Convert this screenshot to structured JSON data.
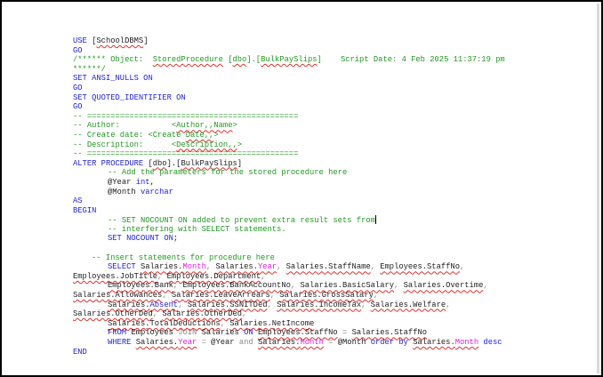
{
  "editor": {
    "lines": [
      {
        "ind": 0,
        "t": [
          [
            "k",
            "USE "
          ],
          [
            "t",
            "["
          ],
          [
            "t",
            "SchoolDBMS",
            1
          ],
          [
            "t",
            "]"
          ]
        ]
      },
      {
        "ind": 0,
        "t": [
          [
            "k",
            "GO"
          ]
        ]
      },
      {
        "ind": 0,
        "t": [
          [
            "c",
            "/****** Object:  "
          ],
          [
            "c",
            "StoredProcedure",
            1
          ],
          [
            "c",
            " ["
          ],
          [
            "c",
            "dbo",
            1
          ],
          [
            "c",
            "].["
          ],
          [
            "c",
            "BulkPaySlips",
            1
          ],
          [
            "c",
            "]    Script Date: 4 Feb 2025 11:37:19 pm"
          ]
        ]
      },
      {
        "ind": 0,
        "t": [
          [
            "c",
            "******/"
          ]
        ]
      },
      {
        "ind": 0,
        "t": [
          [
            "k",
            "SET ANSI_NULLS ON"
          ]
        ]
      },
      {
        "ind": 0,
        "t": [
          [
            "k",
            "GO"
          ]
        ]
      },
      {
        "ind": 0,
        "t": [
          [
            "k",
            "SET QUOTED_IDENTIFIER ON"
          ]
        ]
      },
      {
        "ind": 0,
        "t": [
          [
            "k",
            "GO"
          ]
        ]
      },
      {
        "ind": 0,
        "t": [
          [
            "c",
            "-- ============================================="
          ]
        ]
      },
      {
        "ind": 0,
        "t": [
          [
            "c",
            "-- Author:           <"
          ],
          [
            "c",
            "Author,,Name",
            1
          ],
          [
            "c",
            ">"
          ]
        ]
      },
      {
        "ind": 0,
        "t": [
          [
            "c",
            "-- Create date: <Create "
          ],
          [
            "c",
            "Date,,",
            1
          ],
          [
            "c",
            ">"
          ]
        ]
      },
      {
        "ind": 0,
        "t": [
          [
            "c",
            "-- Description:      <"
          ],
          [
            "c",
            "Description,,",
            1
          ],
          [
            "c",
            ">"
          ]
        ]
      },
      {
        "ind": 0,
        "t": [
          [
            "c",
            "-- ============================================="
          ]
        ]
      },
      {
        "ind": 0,
        "t": [
          [
            "k",
            "ALTER PROCEDURE "
          ],
          [
            "t",
            "["
          ],
          [
            "t",
            "dbo",
            1
          ],
          [
            "t",
            "].["
          ],
          [
            "t",
            "BulkPaySlips",
            1
          ],
          [
            "t",
            "]"
          ]
        ]
      },
      {
        "ind": 2,
        "t": [
          [
            "c",
            "-- Add the parameters for the stored procedure here"
          ]
        ]
      },
      {
        "ind": 2,
        "t": [
          [
            "t",
            "@Year "
          ],
          [
            "k",
            "int"
          ],
          [
            "t",
            ","
          ]
        ]
      },
      {
        "ind": 2,
        "t": [
          [
            "t",
            "@Month "
          ],
          [
            "k",
            "varchar"
          ]
        ]
      },
      {
        "ind": 0,
        "t": [
          [
            "k",
            "AS"
          ]
        ]
      },
      {
        "ind": 0,
        "t": [
          [
            "k",
            "BEGIN"
          ]
        ]
      },
      {
        "ind": 2,
        "t": [
          [
            "c",
            "-- SET NOCOUNT ON added to prevent extra result sets from"
          ]
        ],
        "caret": true
      },
      {
        "ind": 2,
        "t": [
          [
            "c",
            "-- interfering with SELECT statements."
          ]
        ]
      },
      {
        "ind": 2,
        "t": [
          [
            "k",
            "SET NOCOUNT ON"
          ],
          [
            "t",
            ";"
          ]
        ]
      },
      {
        "ind": 0,
        "t": []
      },
      {
        "ind": 1,
        "t": [
          [
            "c",
            "-- Insert statements for procedure here"
          ]
        ]
      },
      {
        "ind": 2,
        "t": [
          [
            "k",
            "SELECT "
          ],
          [
            "t",
            "Salaries.",
            1
          ],
          [
            "m",
            "Month",
            1
          ],
          [
            "g",
            ", "
          ],
          [
            "t",
            "Salaries.",
            1
          ],
          [
            "m",
            "Year",
            1
          ],
          [
            "g",
            ", "
          ],
          [
            "t",
            "Salaries.StaffName",
            1
          ],
          [
            "g",
            ", "
          ],
          [
            "t",
            "Employees.StaffNo",
            1
          ],
          [
            "g",
            ","
          ]
        ]
      },
      {
        "ind": 0,
        "t": [
          [
            "t",
            "Employees.JobTitle",
            1
          ],
          [
            "g",
            ", "
          ],
          [
            "t",
            "Employees.Department",
            1
          ],
          [
            "g",
            ","
          ]
        ]
      },
      {
        "ind": 2,
        "t": [
          [
            "t",
            "Employees.Bank",
            1
          ],
          [
            "g",
            ", "
          ],
          [
            "t",
            "Employees.BankAccountNo",
            1
          ],
          [
            "g",
            ", "
          ],
          [
            "t",
            "Salaries.BasicSalary",
            1
          ],
          [
            "g",
            ", "
          ],
          [
            "t",
            "Salaries.Overtime",
            1
          ],
          [
            "g",
            ","
          ]
        ]
      },
      {
        "ind": 0,
        "t": [
          [
            "t",
            "Salaries.Allowances",
            1
          ],
          [
            "g",
            ", "
          ],
          [
            "t",
            "Salaries.LeaveArrears",
            1
          ],
          [
            "g",
            ", "
          ],
          [
            "t",
            "Salaries.GrossSalary",
            1
          ],
          [
            "g",
            ","
          ]
        ]
      },
      {
        "ind": 2,
        "t": [
          [
            "t",
            "Salaries.",
            1
          ],
          [
            "k",
            "Absent",
            1
          ],
          [
            "g",
            ", "
          ],
          [
            "t",
            "Salaries.SSNITDed",
            1
          ],
          [
            "g",
            ", "
          ],
          [
            "t",
            "Salaries.IncomeTax",
            1
          ],
          [
            "g",
            ", "
          ],
          [
            "t",
            "Salaries.Welfare",
            1
          ],
          [
            "g",
            ","
          ]
        ]
      },
      {
        "ind": 0,
        "t": [
          [
            "t",
            "Salaries.OtherDed",
            1
          ],
          [
            "g",
            ", "
          ],
          [
            "t",
            "Salaries.OtherDed",
            1
          ],
          [
            "g",
            ","
          ]
        ]
      },
      {
        "ind": 2,
        "t": [
          [
            "t",
            "Salaries.TotalDeductions",
            1
          ],
          [
            "g",
            ", "
          ],
          [
            "t",
            "Salaries.NetIncome",
            1
          ]
        ]
      },
      {
        "ind": 2,
        "t": [
          [
            "k",
            "FROM "
          ],
          [
            "t",
            "Employees "
          ],
          [
            "g",
            "JOIN "
          ],
          [
            "t",
            "Salaries "
          ],
          [
            "k",
            "ON "
          ],
          [
            "t",
            "Employees.StaffNo",
            1
          ],
          [
            "g",
            " = "
          ],
          [
            "t",
            "Salaries.StaffNo",
            1
          ]
        ]
      },
      {
        "ind": 2,
        "t": [
          [
            "k",
            "WHERE "
          ],
          [
            "t",
            "Salaries.",
            1
          ],
          [
            "m",
            "Year",
            1
          ],
          [
            "g",
            " = "
          ],
          [
            "t",
            "@Year "
          ],
          [
            "g",
            "and "
          ],
          [
            "t",
            "Salaries.",
            1
          ],
          [
            "m",
            "Month",
            1
          ],
          [
            "g",
            " = "
          ],
          [
            "t",
            "@Month "
          ],
          [
            "k",
            "order by "
          ],
          [
            "t",
            "Salaries.",
            1
          ],
          [
            "m",
            "Month",
            1
          ],
          [
            "k",
            " desc"
          ]
        ]
      },
      {
        "ind": 0,
        "t": [
          [
            "k",
            "END"
          ]
        ]
      }
    ]
  }
}
